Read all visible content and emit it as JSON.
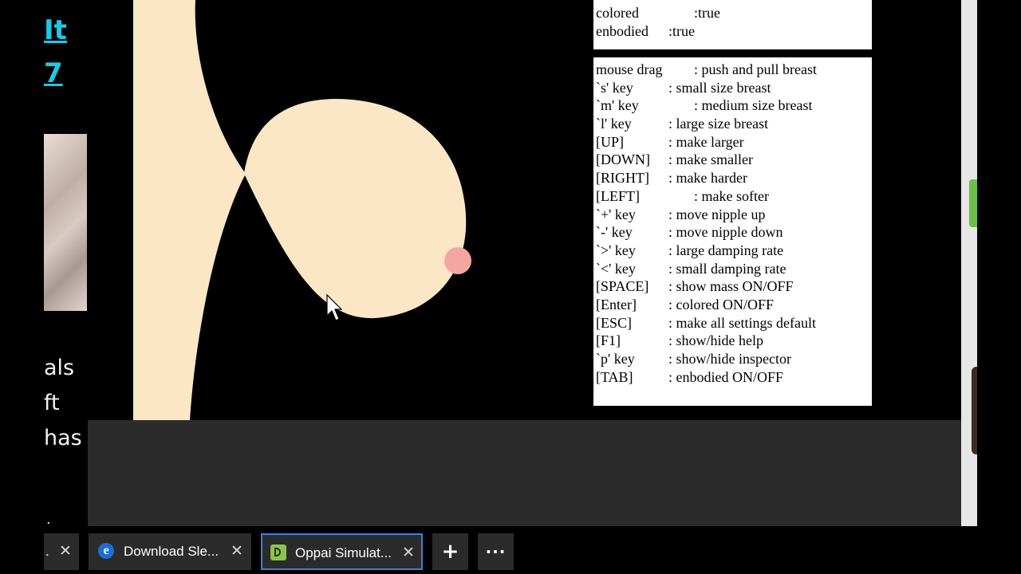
{
  "background_left": {
    "links": [
      "It",
      "7"
    ],
    "words": [
      "als",
      "ft",
      "has"
    ],
    "dot": "."
  },
  "status_panel": {
    "rows": [
      {
        "key": "colored",
        "value": ":true"
      },
      {
        "key": "enbodied",
        "value": ":true"
      }
    ]
  },
  "help_panel": {
    "rows": [
      {
        "key": "mouse drag",
        "value": ": push and pull breast"
      },
      {
        "key": "`s' key",
        "value": ": small size breast"
      },
      {
        "key": "`m' key",
        "value": ": medium size breast"
      },
      {
        "key": "`l' key",
        "value": ": large size breast"
      },
      {
        "key": "[UP]",
        "value": ": make larger"
      },
      {
        "key": "[DOWN]",
        "value": ": make smaller"
      },
      {
        "key": "[RIGHT]",
        "value": ": make harder"
      },
      {
        "key": "[LEFT]",
        "value": ": make softer"
      },
      {
        "key": "`+' key",
        "value": ": move nipple up"
      },
      {
        "key": "`-' key",
        "value": ": move nipple down"
      },
      {
        "key": "`>' key",
        "value": ": large damping rate"
      },
      {
        "key": "`<' key",
        "value": ": small damping rate"
      },
      {
        "key": "[SPACE]",
        "value": ": show mass ON/OFF"
      },
      {
        "key": "[Enter]",
        "value": ": colored ON/OFF"
      },
      {
        "key": "[ESC]",
        "value": ": make all settings default"
      },
      {
        "key": "[F1]",
        "value": ": show/hide help"
      },
      {
        "key": "`p' key",
        "value": ": show/hide inspector"
      },
      {
        "key": "[TAB]",
        "value": ": enbodied ON/OFF"
      }
    ]
  },
  "tabs": [
    {
      "title": ".",
      "close": "✕"
    },
    {
      "title": "Download Sle...",
      "close": "✕",
      "favicon": "ie-icon"
    },
    {
      "title": "Oppai Simulat...",
      "close": "✕",
      "favicon": "d-app-icon",
      "active": true
    }
  ],
  "tab_actions": {
    "new_tab": "+",
    "more": "···"
  },
  "colors": {
    "skin": "#fbe6c6",
    "nipple": "#f4a7a0",
    "active_tab_border": "#3e7fd9",
    "link": "#1ec8e6",
    "tab_bg": "#2b2b2b"
  }
}
